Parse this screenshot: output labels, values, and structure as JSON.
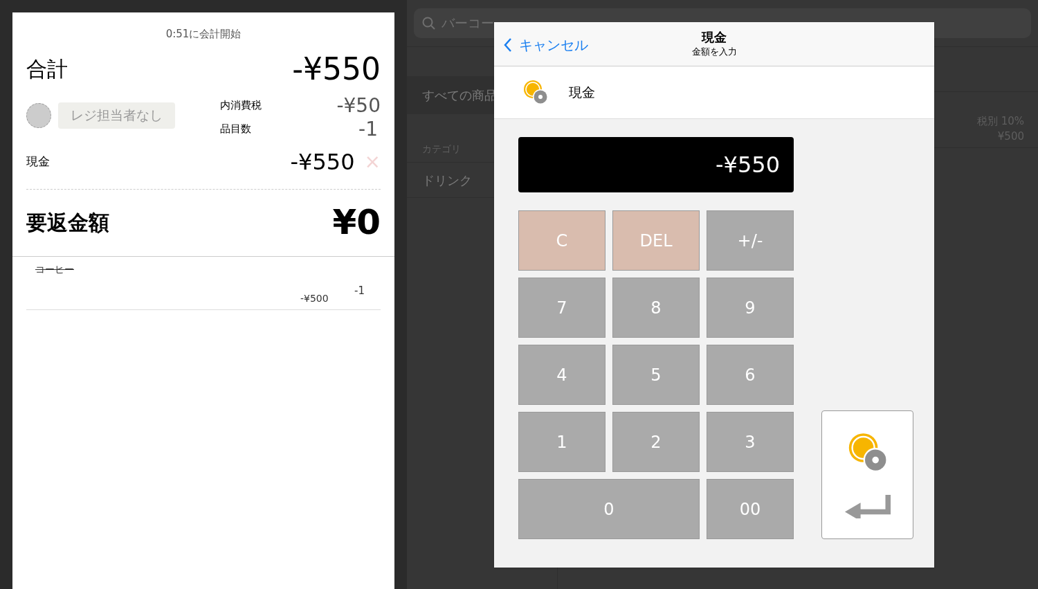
{
  "receipt": {
    "started": "0:51に会計開始",
    "total_label": "合計",
    "total": "-¥550",
    "staff": "レジ担当者なし",
    "tax_label": "内消費税",
    "tax": "-¥50",
    "count_label": "品目数",
    "count": "-1",
    "payment_label": "現金",
    "payment": "-¥550",
    "remove": "×",
    "change_label": "要返金額",
    "change": "¥0",
    "items": [
      {
        "name": "コーヒー",
        "voided": true,
        "price": "-¥500",
        "qty": "-1"
      }
    ]
  },
  "background": {
    "search_placeholder": "バーコー",
    "all_products": "すべての商品",
    "category_heading": "カテゴリ",
    "categories": [
      "ドリンク"
    ],
    "product_tax": "税別 10%",
    "product_price": "¥500"
  },
  "modal": {
    "cancel": "キャンセル",
    "title": "現金",
    "subtitle": "金額を入力",
    "method": "現金",
    "display": "-¥550",
    "keys": [
      {
        "label": "C",
        "kind": "function"
      },
      {
        "label": "DEL",
        "kind": "function"
      },
      {
        "label": "+/-",
        "kind": "digit"
      },
      {
        "label": "7",
        "kind": "digit"
      },
      {
        "label": "8",
        "kind": "digit"
      },
      {
        "label": "9",
        "kind": "digit"
      },
      {
        "label": "4",
        "kind": "digit"
      },
      {
        "label": "5",
        "kind": "digit"
      },
      {
        "label": "6",
        "kind": "digit"
      },
      {
        "label": "1",
        "kind": "digit"
      },
      {
        "label": "2",
        "kind": "digit"
      },
      {
        "label": "3",
        "kind": "digit"
      },
      {
        "label": "0",
        "kind": "wide"
      },
      {
        "label": "00",
        "kind": "digit"
      }
    ]
  }
}
